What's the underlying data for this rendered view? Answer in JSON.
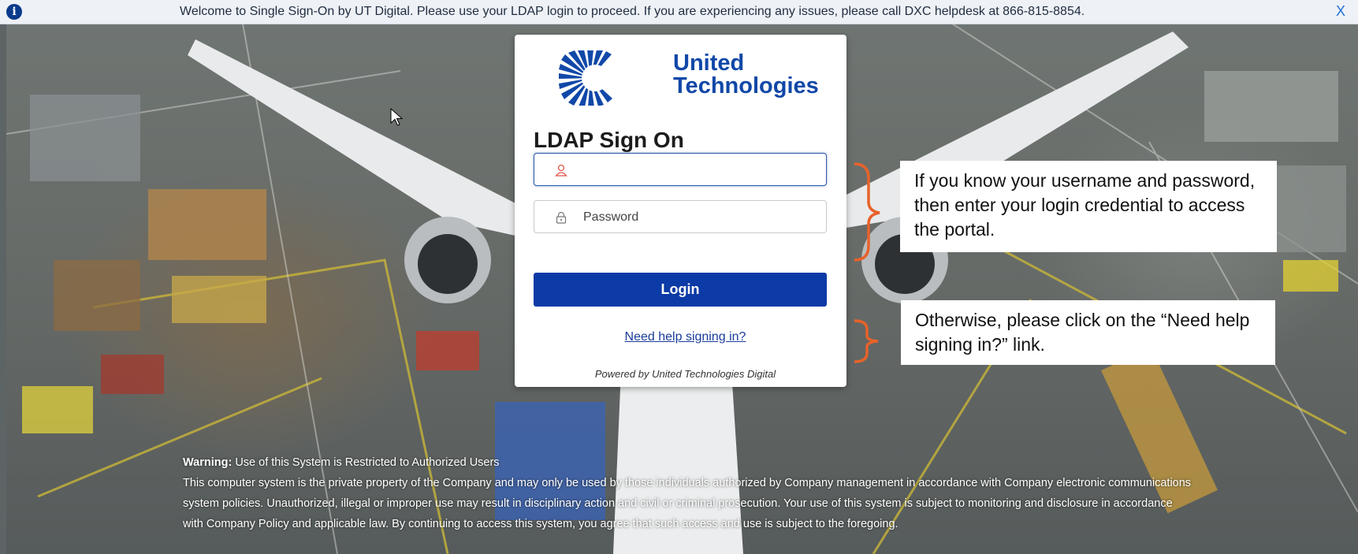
{
  "banner": {
    "info_icon": "info-icon",
    "message": "Welcome to Single Sign-On by UT Digital. Please use your LDAP login to proceed. If you are experiencing any issues, please call DXC helpdesk at 866-815-8854.",
    "close_label": "X"
  },
  "login": {
    "logo_line1": "United",
    "logo_line2": "Technologies",
    "heading": "LDAP Sign On",
    "username_value": "",
    "username_icon": "user-icon",
    "password_placeholder": "Password",
    "password_icon": "lock-icon",
    "login_label": "Login",
    "help_link": "Need help signing in?",
    "powered_by": "Powered by United Technologies Digital"
  },
  "callouts": {
    "credentials": "If you know your username and password, then enter your login credential to access the portal.",
    "help": "Otherwise, please click on the “Need help signing in?” link."
  },
  "warning": {
    "label": "Warning:",
    "title": " Use of this System is Restricted to Authorized Users",
    "body": "This computer system is the private property of the Company and may only be used by those individuals authorized by Company management in accordance with Company electronic communications system policies. Unauthorized, illegal or improper use may result in disciplinary action and civil or criminal prosecution. Your use of this system is subject to monitoring and disclosure in accordance with Company Policy and applicable law. By continuing to access this system, you agree that such access and use is subject to the foregoing."
  },
  "colors": {
    "brand_blue": "#1148a8",
    "button_blue": "#0c3aa6",
    "brace_orange": "#e8622a"
  }
}
